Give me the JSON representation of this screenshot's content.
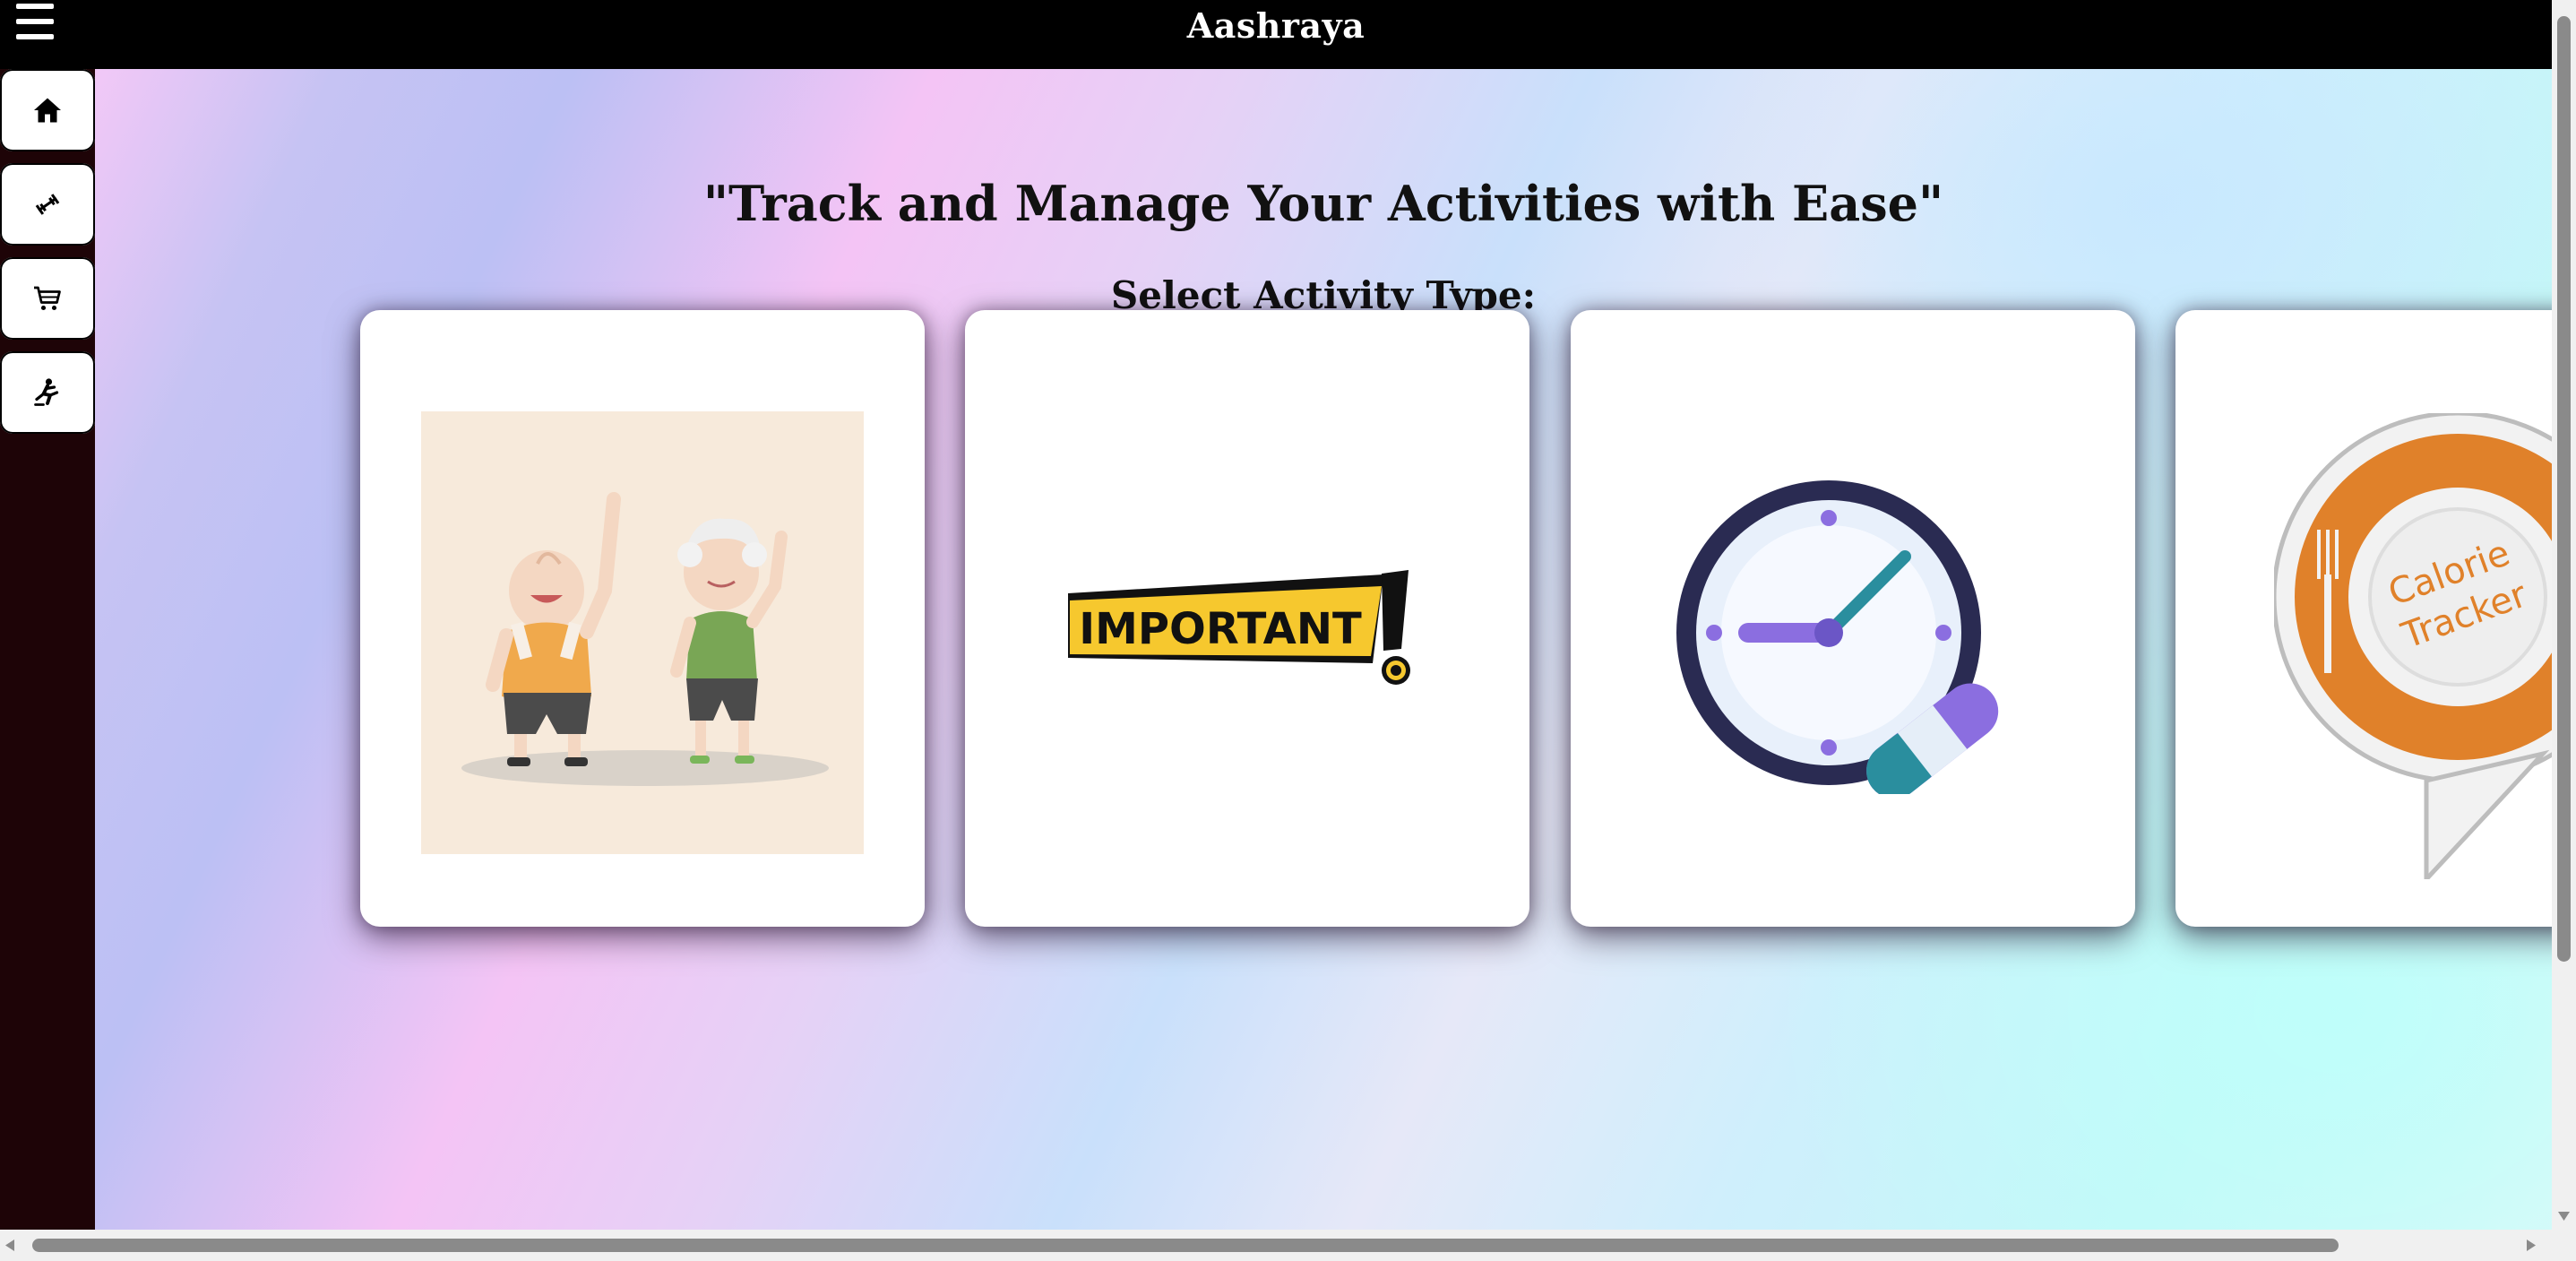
{
  "app": {
    "title": "Aashraya"
  },
  "sidebar": {
    "items": [
      {
        "icon": "home-icon"
      },
      {
        "icon": "dumbbell-icon"
      },
      {
        "icon": "cart-icon"
      },
      {
        "icon": "person-activity-icon"
      }
    ]
  },
  "main": {
    "headline": "\"Track and Manage Your Activities with Ease\"",
    "subheadline": "Select Activity Type:",
    "cards": [
      {
        "image": "exercise-seniors-illustration"
      },
      {
        "image": "important-banner",
        "text": "IMPORTANT"
      },
      {
        "image": "medication-clock-illustration"
      },
      {
        "image": "calorie-tracker-logo",
        "text_line1": "Calorie",
        "text_line2": "Tracker"
      }
    ]
  },
  "colors": {
    "topbar": "#000000",
    "sidebar": "#1e0407",
    "important_yellow": "#f6c82e",
    "calorie_orange": "#e0812a",
    "clock_navy": "#2a2b52",
    "pill_purple": "#8b6ee0",
    "pill_teal": "#2a8e9e"
  }
}
